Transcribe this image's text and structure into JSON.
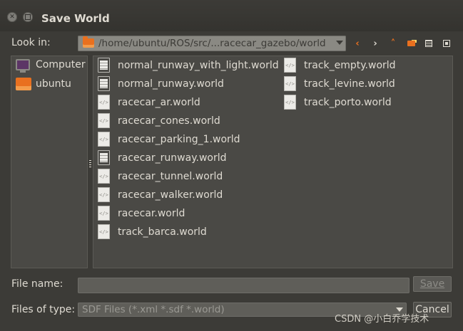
{
  "window": {
    "title": "Save World"
  },
  "toolbar": {
    "look_in_label": "Look in:",
    "path": "/home/ubuntu/ROS/src/...racecar_gazebo/world",
    "path_icon": "folder-icon",
    "buttons": [
      "back-icon",
      "forward-icon",
      "up-icon",
      "new-folder-icon",
      "list-view-icon",
      "detail-view-icon"
    ]
  },
  "sidebar": {
    "items": [
      {
        "label": "Computer",
        "icon": "computer-icon"
      },
      {
        "label": "ubuntu",
        "icon": "folder-icon"
      }
    ]
  },
  "files": {
    "column1": [
      {
        "name": "normal_runway_with_light.world",
        "icon": "text-file-icon"
      },
      {
        "name": "normal_runway.world",
        "icon": "text-file-icon"
      },
      {
        "name": "racecar_ar.world",
        "icon": "xml-file-icon"
      },
      {
        "name": "racecar_cones.world",
        "icon": "xml-file-icon"
      },
      {
        "name": "racecar_parking_1.world",
        "icon": "xml-file-icon"
      },
      {
        "name": "racecar_runway.world",
        "icon": "text-file-icon"
      },
      {
        "name": "racecar_tunnel.world",
        "icon": "xml-file-icon"
      },
      {
        "name": "racecar_walker.world",
        "icon": "xml-file-icon"
      },
      {
        "name": "racecar.world",
        "icon": "xml-file-icon"
      },
      {
        "name": "track_barca.world",
        "icon": "xml-file-icon"
      }
    ],
    "column2": [
      {
        "name": "track_empty.world",
        "icon": "xml-file-icon"
      },
      {
        "name": "track_levine.world",
        "icon": "xml-file-icon"
      },
      {
        "name": "track_porto.world",
        "icon": "xml-file-icon"
      }
    ]
  },
  "form": {
    "file_name_label": "File name:",
    "file_name_value": "",
    "file_type_label": "Files of type:",
    "file_type_value": "SDF Files (*.xml *.sdf *.world)",
    "save_label": "Save",
    "cancel_label": "Cancel"
  },
  "watermark": "CSDN @小白乔学技术"
}
